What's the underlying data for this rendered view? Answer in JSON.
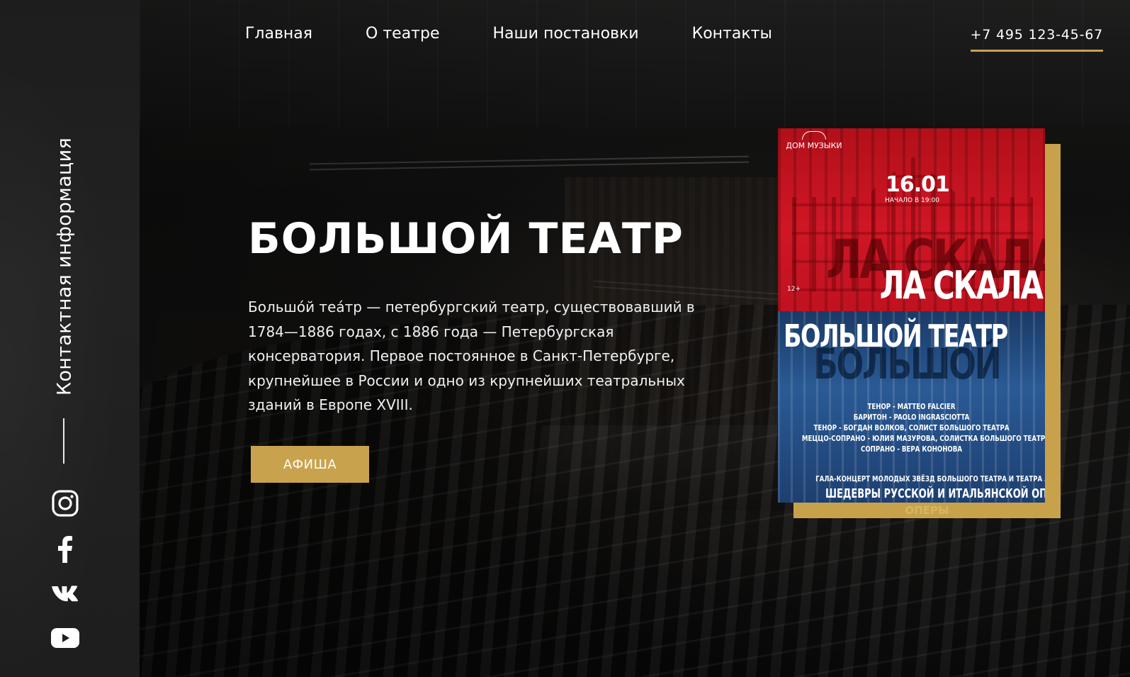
{
  "sidebar": {
    "vertical_label": "Контактная информация",
    "social": [
      {
        "icon": "instagram-icon"
      },
      {
        "icon": "facebook-icon"
      },
      {
        "icon": "vk-icon"
      },
      {
        "icon": "youtube-icon"
      }
    ]
  },
  "nav": {
    "items": [
      {
        "label": "Главная"
      },
      {
        "label": "О театре"
      },
      {
        "label": "Наши постановки"
      },
      {
        "label": "Контакты"
      }
    ],
    "phone": "+7 495 123-45-67"
  },
  "hero": {
    "title": "БОЛЬШОЙ ТЕАТР",
    "description": "Большо́й теа́тр — петербургский театр, существовавший в 1784—1886 годах, с 1886 года — Петербургская консерватория. Первое постоянное в Санкт-Петербурге, крупнейшее в России и одно из крупнейших театральных зданий в Европе XVIII.",
    "button_label": "АФИША"
  },
  "poster": {
    "logo": "ДОМ МУЗЫКИ",
    "date": "16.01",
    "time": "НАЧАЛО В 19:00",
    "age": "12+",
    "ghost_top": "ЛА СКАЛА",
    "title_top": "ЛА СКАЛА",
    "title_bottom": "БОЛЬШОЙ ТЕАТР",
    "ghost_bottom": "БОЛЬШОЙ",
    "cast": [
      "ТЕНОР - MATTEO FALCIER",
      "БАРИТОН - PAOLO INGRASCIOTTA",
      "ТЕНОР - БОГДАН ВОЛКОВ, СОЛИСТ БОЛЬШОГО ТЕАТРА",
      "МЕЦЦО-СОПРАНО - ЮЛИЯ МАЗУРОВА, СОЛИСТКА БОЛЬШОГО ТЕАТРА",
      "СОПРАНО - ВЕРА КОНОНОВА"
    ],
    "gala": "ГАЛА-КОНЦЕРТ МОЛОДЫХ ЗВЁЗД БОЛЬШОГО ТЕАТРА И ТЕАТРА ЛА СКАЛА:",
    "masterpieces": "ШЕДЕВРЫ РУССКОЙ И ИТАЛЬЯНСКОЙ ОПЕРЫ",
    "masterpieces_ghost": "ШЕДЕВРЫ РУССКОЙ И ИТАЛЬЯНСКОЙ ОПЕРЫ"
  },
  "colors": {
    "accent_gold": "#c9a24d",
    "sidebar_bg": "#1f1f1f",
    "poster_red": "#d01625",
    "poster_blue": "#1d3f70"
  }
}
